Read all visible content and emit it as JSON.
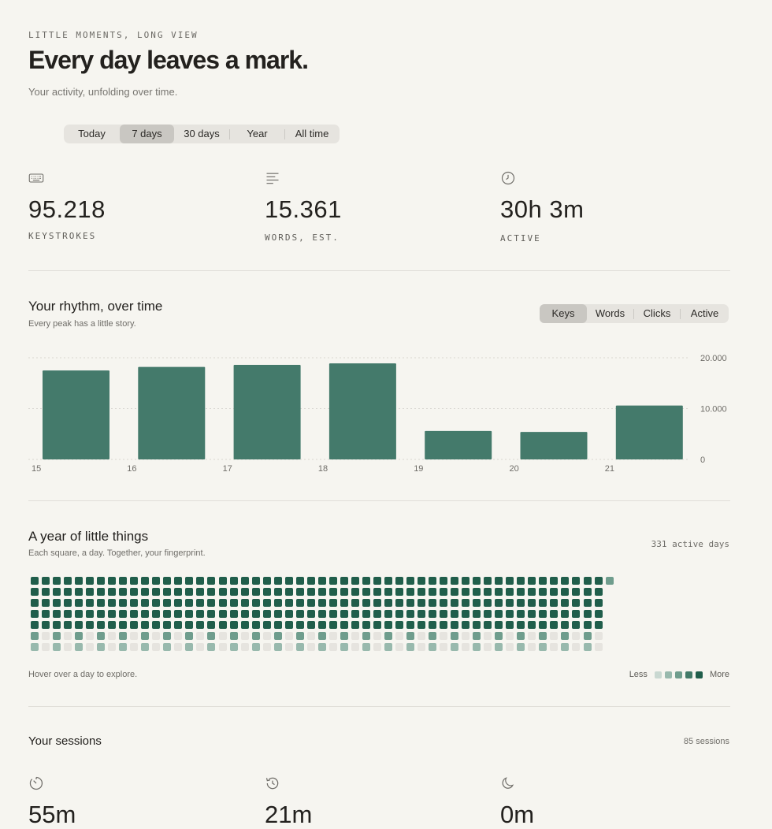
{
  "header": {
    "eyebrow": "LITTLE MOMENTS, LONG VIEW",
    "title": "Every day leaves a mark.",
    "subtitle": "Your activity, unfolding over time."
  },
  "range_tabs": {
    "items": [
      "Today",
      "7 days",
      "30 days",
      "Year",
      "All time"
    ],
    "selected": "7 days"
  },
  "stats": [
    {
      "icon": "keyboard-icon",
      "value": "95.218",
      "label": "KEYSTROKES"
    },
    {
      "icon": "text-lines-icon",
      "value": "15.361",
      "label": "WORDS, EST."
    },
    {
      "icon": "clock-icon",
      "value": "30h 3m",
      "label": "ACTIVE"
    }
  ],
  "rhythm": {
    "title": "Your rhythm, over time",
    "subtitle": "Every peak has a little story.",
    "metric_tabs": [
      "Keys",
      "Words",
      "Clicks",
      "Active"
    ],
    "selected_metric": "Keys"
  },
  "chart_data": {
    "type": "bar",
    "categories": [
      "15",
      "16",
      "17",
      "18",
      "19",
      "20",
      "21"
    ],
    "values": [
      17500,
      18200,
      18600,
      18900,
      5600,
      5400,
      10600
    ],
    "ylim": [
      0,
      20000
    ],
    "y_ticks": [
      "0",
      "10.000",
      "20.000"
    ],
    "y_tick_values": [
      0,
      10000,
      20000
    ],
    "grid": true,
    "y_axis_side": "right",
    "bar_color": "#447a6b"
  },
  "year": {
    "title": "A year of little things",
    "subtitle": "Each square, a day. Together, your fingerprint.",
    "active_days": "331 active days",
    "hover_hint": "Hover over a day to explore.",
    "legend_less": "Less",
    "legend_more": "More",
    "legend_colors": [
      "#c9d8d1",
      "#98b9ad",
      "#6f9d8d",
      "#427a68",
      "#205e4b"
    ],
    "weeks": 52,
    "weekday_intensity": [
      4,
      4,
      4,
      4,
      4,
      2,
      1
    ],
    "days_in_last_week": 1
  },
  "sessions": {
    "title": "Your sessions",
    "count": "85 sessions",
    "items": [
      {
        "icon": "timer-icon",
        "value": "55m"
      },
      {
        "icon": "history-icon",
        "value": "21m"
      },
      {
        "icon": "moon-icon",
        "value": "0m"
      }
    ]
  },
  "colors": {
    "background": "#f6f5f0",
    "accent": "#447a6b",
    "text": "#23211e"
  }
}
